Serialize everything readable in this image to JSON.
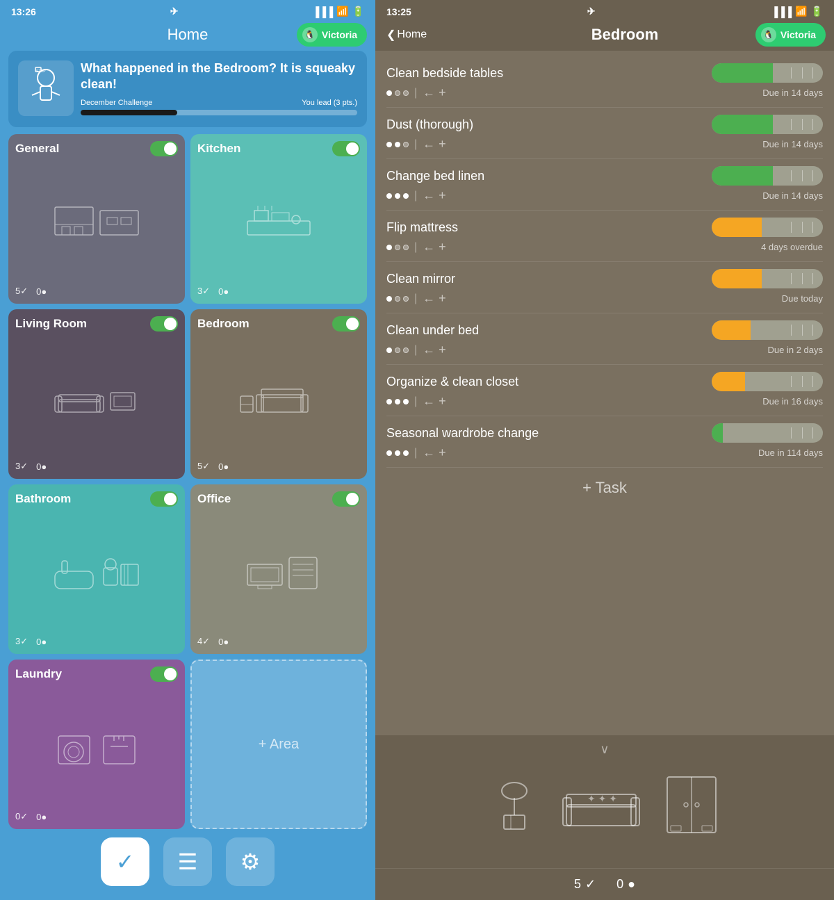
{
  "left": {
    "statusBar": {
      "time": "13:26",
      "locationIcon": "▶"
    },
    "header": {
      "title": "Home",
      "profileLabel": "Victoria"
    },
    "banner": {
      "title": "What happened in the Bedroom? It is squeaky clean!",
      "challengeLabel": "December Challenge",
      "progressLabel": "You lead (3 pts.)"
    },
    "rooms": [
      {
        "id": "general",
        "name": "General",
        "completed": 5,
        "pending": 0,
        "colorClass": "general"
      },
      {
        "id": "kitchen",
        "name": "Kitchen",
        "completed": 3,
        "pending": 0,
        "colorClass": "kitchen"
      },
      {
        "id": "living-room",
        "name": "Living Room",
        "completed": 3,
        "pending": 0,
        "colorClass": "living-room"
      },
      {
        "id": "bedroom",
        "name": "Bedroom",
        "completed": 5,
        "pending": 0,
        "colorClass": "bedroom"
      },
      {
        "id": "bathroom",
        "name": "Bathroom",
        "completed": 3,
        "pending": 0,
        "colorClass": "bathroom"
      },
      {
        "id": "office",
        "name": "Office",
        "completed": 4,
        "pending": 0,
        "colorClass": "office"
      },
      {
        "id": "laundry",
        "name": "Laundry",
        "completed": 0,
        "pending": 0,
        "colorClass": "laundry"
      }
    ],
    "addArea": "+ Area",
    "nav": {
      "checkIcon": "✓",
      "listIcon": "≡",
      "settingsIcon": "⚙"
    }
  },
  "right": {
    "statusBar": {
      "time": "13:25",
      "locationIcon": "▶"
    },
    "header": {
      "backLabel": "Home",
      "title": "Bedroom",
      "profileLabel": "Victoria"
    },
    "tasks": [
      {
        "name": "Clean bedside tables",
        "dots": [
          1,
          0,
          0
        ],
        "due": "Due in 14 days",
        "fillColor": "#4CAF50",
        "fillWidth": "55%"
      },
      {
        "name": "Dust (thorough)",
        "dots": [
          1,
          1,
          0
        ],
        "due": "Due in 14 days",
        "fillColor": "#4CAF50",
        "fillWidth": "55%"
      },
      {
        "name": "Change bed linen",
        "dots": [
          1,
          1,
          1
        ],
        "due": "Due in 14 days",
        "fillColor": "#4CAF50",
        "fillWidth": "55%"
      },
      {
        "name": "Flip mattress",
        "dots": [
          1,
          0,
          0
        ],
        "due": "4 days overdue",
        "fillColor": "#F5A623",
        "fillWidth": "45%"
      },
      {
        "name": "Clean mirror",
        "dots": [
          1,
          0,
          0
        ],
        "due": "Due today",
        "fillColor": "#F5A623",
        "fillWidth": "45%"
      },
      {
        "name": "Clean under bed",
        "dots": [
          1,
          0,
          0
        ],
        "due": "Due in 2 days",
        "fillColor": "#F5A623",
        "fillWidth": "35%"
      },
      {
        "name": "Organize & clean closet",
        "dots": [
          1,
          1,
          1
        ],
        "due": "Due in 16 days",
        "fillColor": "#F5A623",
        "fillWidth": "30%"
      },
      {
        "name": "Seasonal wardrobe change",
        "dots": [
          1,
          1,
          1
        ],
        "due": "Due in 114 days",
        "fillColor": "#4CAF50",
        "fillWidth": "10%"
      }
    ],
    "addTask": "+ Task",
    "stats": {
      "completed": 5,
      "pending": 0
    }
  }
}
